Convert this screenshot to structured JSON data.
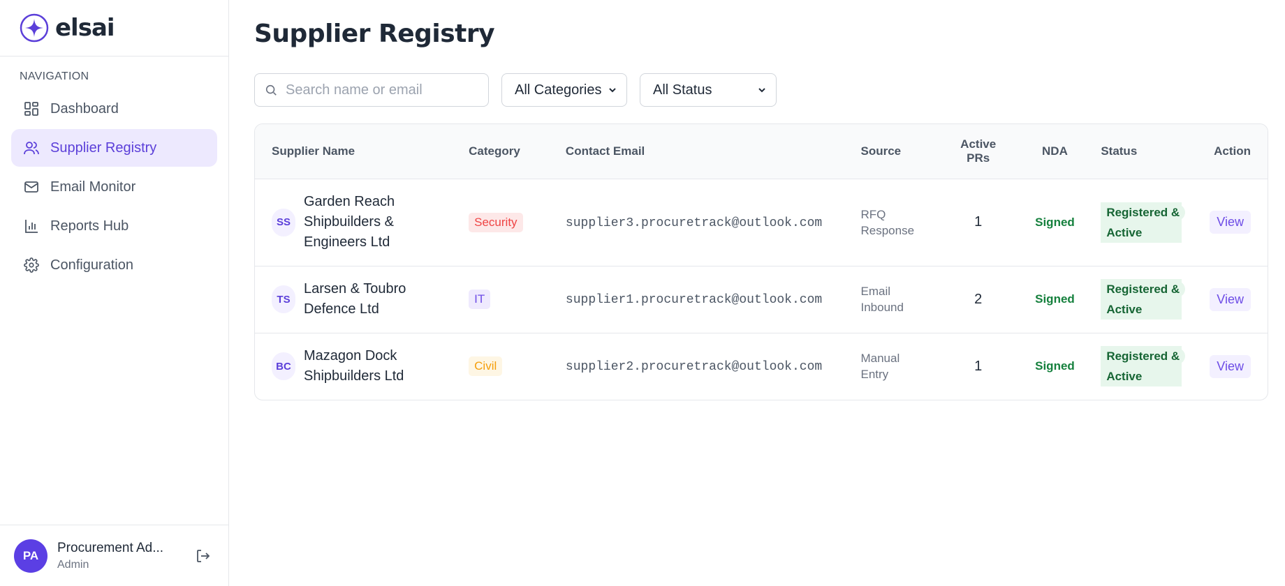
{
  "brand": {
    "name": "elsai"
  },
  "sidebar": {
    "heading": "NAVIGATION",
    "items": [
      {
        "label": "Dashboard",
        "icon": "dashboard-icon"
      },
      {
        "label": "Supplier Registry",
        "icon": "users-icon",
        "active": true
      },
      {
        "label": "Email Monitor",
        "icon": "mail-icon"
      },
      {
        "label": "Reports Hub",
        "icon": "bar-chart-icon"
      },
      {
        "label": "Configuration",
        "icon": "gear-icon"
      }
    ],
    "user": {
      "initials": "PA",
      "name": "Procurement Ad...",
      "role": "Admin"
    }
  },
  "page": {
    "title": "Supplier Registry"
  },
  "filters": {
    "search_placeholder": "Search name or email",
    "category": "All Categories",
    "status": "All Status"
  },
  "table": {
    "headers": {
      "name": "Supplier Name",
      "category": "Category",
      "email": "Contact Email",
      "source": "Source",
      "prs_line1": "Active",
      "prs_line2": "PRs",
      "nda": "NDA",
      "status": "Status",
      "action": "Action"
    },
    "rows": [
      {
        "initials": "SS",
        "name": "Garden Reach Shipbuilders & Engineers Ltd",
        "category": "Security",
        "email": "supplier3.procuretrack@outlook.com",
        "source": "RFQ Response",
        "active_prs": "1",
        "nda": "Signed",
        "status": "Registered & Active",
        "action": "View"
      },
      {
        "initials": "TS",
        "name": "Larsen & Toubro Defence Ltd",
        "category": "IT",
        "email": "supplier1.procuretrack@outlook.com",
        "source": "Email Inbound",
        "active_prs": "2",
        "nda": "Signed",
        "status": "Registered & Active",
        "action": "View"
      },
      {
        "initials": "BC",
        "name": "Mazagon Dock Shipbuilders Ltd",
        "category": "Civil",
        "email": "supplier2.procuretrack@outlook.com",
        "source": "Manual Entry",
        "active_prs": "1",
        "nda": "Signed",
        "status": "Registered & Active",
        "action": "View"
      }
    ]
  },
  "colors": {
    "accent": "#5b3fd9",
    "security_bg": "#fde8e8",
    "security_fg": "#ef4444",
    "it_bg": "#efeafe",
    "it_fg": "#6d4ce6",
    "civil_bg": "#fef6e4",
    "civil_fg": "#f59e0b"
  }
}
